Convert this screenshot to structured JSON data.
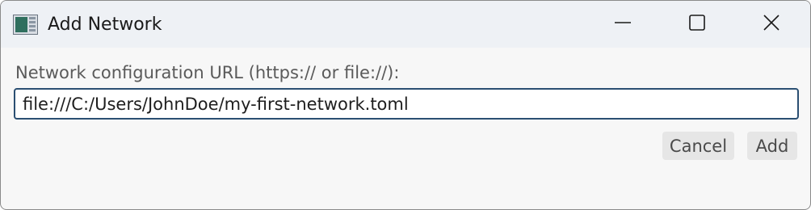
{
  "window": {
    "title": "Add Network",
    "icon": "app-window-icon"
  },
  "titlebar_controls": {
    "minimize": "minimize-icon",
    "maximize": "maximize-icon",
    "close": "close-icon"
  },
  "form": {
    "url_label": "Network configuration URL (https:// or file://):",
    "url_value": "file:///C:/Users/JohnDoe/my-first-network.toml"
  },
  "buttons": {
    "cancel_label": "Cancel",
    "add_label": "Add"
  },
  "colors": {
    "input_border": "#2b4f72",
    "titlebar_bg": "#eef1f5",
    "dialog_bg": "#f7f7f7",
    "button_bg": "#e6e6e6"
  }
}
